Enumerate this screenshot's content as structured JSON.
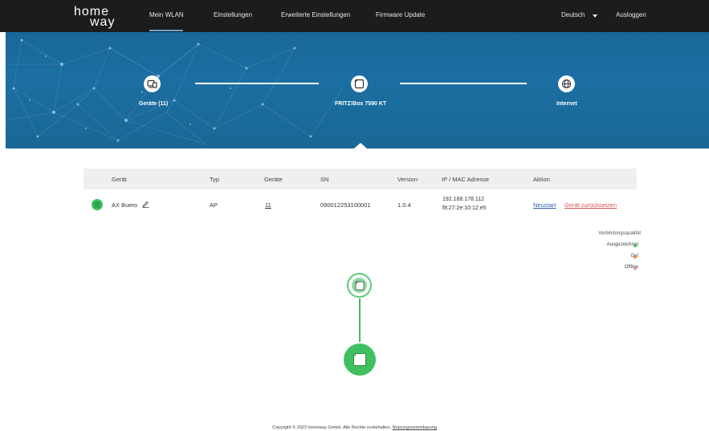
{
  "logo": {
    "line1": "home",
    "line2": "way"
  },
  "nav": {
    "items": [
      {
        "label": "Mein WLAN",
        "active": true
      },
      {
        "label": "Einstellungen",
        "active": false
      },
      {
        "label": "Erweiterte Einstellungen",
        "active": false
      },
      {
        "label": "Firmware Update",
        "active": false
      }
    ],
    "language": "Deutsch",
    "logout": "Ausloggen",
    "active_color": "#6aa4d6"
  },
  "banner": {
    "nodes": [
      {
        "label": "Geräte (11)",
        "icon": "devices-icon"
      },
      {
        "label": "FRITZ!Box 7590 KT",
        "icon": "router-icon"
      },
      {
        "label": "Internet",
        "icon": "globe-icon"
      }
    ]
  },
  "table": {
    "headers": [
      "Gerät",
      "Typ",
      "Geräte",
      "SN",
      "Version",
      "IP / MAC Adresse",
      "Aktion"
    ],
    "rows": [
      {
        "name": "AX Buero",
        "type": "AP",
        "devices": "11",
        "sn": "090012253100001",
        "version": "1.0.4",
        "ip": "192.168.178.112",
        "mac": "f8:27:2e:10:12:e5",
        "action_restart": "Neustart",
        "action_reset": "Gerät zurücksetzen",
        "status_color": "#3fbf5f"
      }
    ]
  },
  "legend": {
    "title": "Verbindungsqualität",
    "items": [
      {
        "label": "Ausgezeichnet",
        "color": "#3fbf5f"
      },
      {
        "label": "Gut",
        "color": "#f0883a"
      },
      {
        "label": "Offline",
        "color": "#d98aa0"
      }
    ]
  },
  "footer": {
    "text": "Copyright © 2023 homeway GmbH. Alle Rechte vorbehalten.",
    "link": "Nutzungsvereinbarung"
  }
}
